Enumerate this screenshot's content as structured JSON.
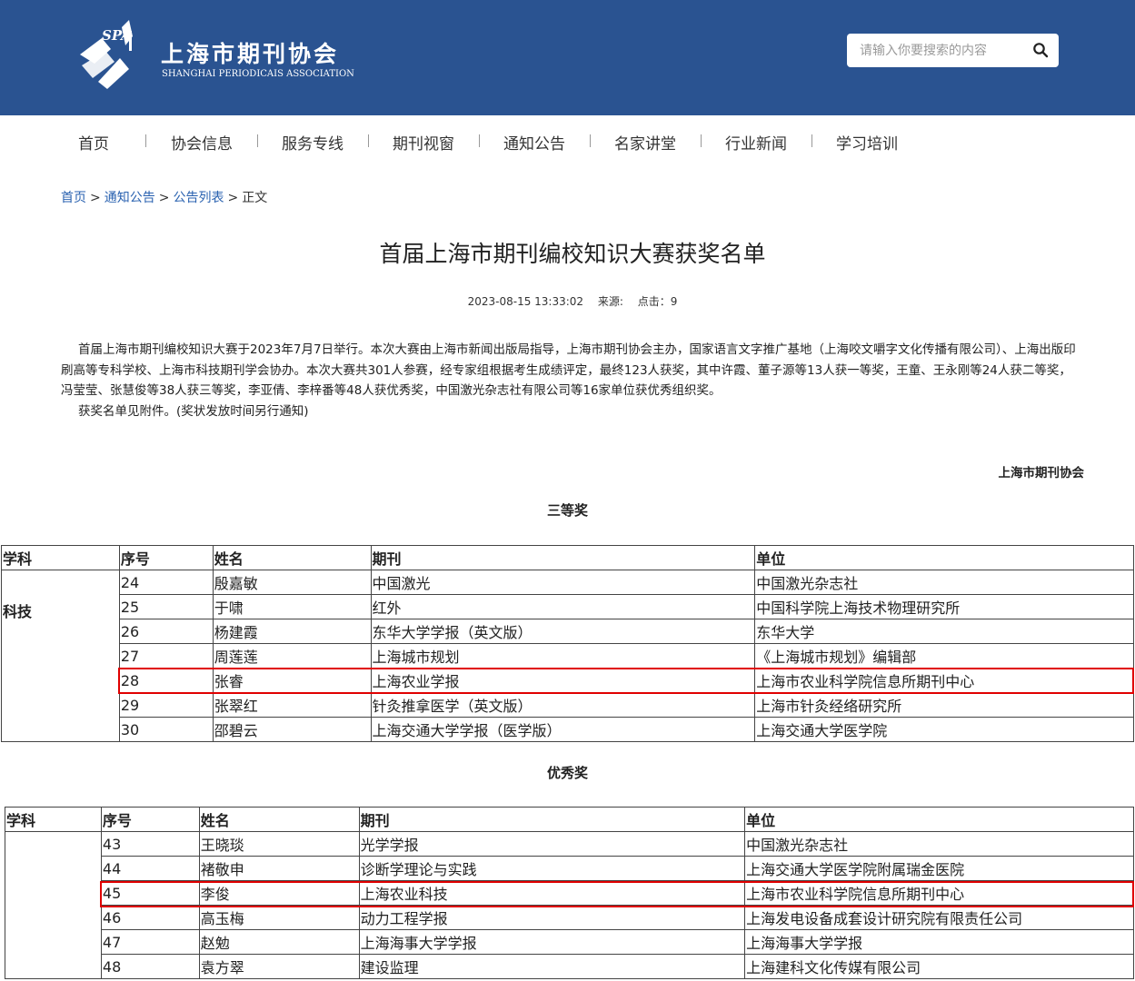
{
  "header": {
    "logo_text": "SPA",
    "title": "上海市期刊协会",
    "subtitle": "SHANGHAI PERIODICAIS ASSOCIATION",
    "search_placeholder": "请输入你要搜索的内容",
    "colors": {
      "header_bg": "#2a5391",
      "link": "#2a62b0",
      "highlight": "#e00000"
    }
  },
  "nav": {
    "items": [
      {
        "label": "首页"
      },
      {
        "label": "协会信息"
      },
      {
        "label": "服务专线"
      },
      {
        "label": "期刊视窗"
      },
      {
        "label": "通知公告"
      },
      {
        "label": "名家讲堂"
      },
      {
        "label": "行业新闻"
      },
      {
        "label": "学习培训"
      }
    ]
  },
  "breadcrumb": {
    "items": [
      "首页",
      "通知公告",
      "公告列表"
    ],
    "separator": ">",
    "current": "正文"
  },
  "article": {
    "title": "首届上海市期刊编校知识大赛获奖名单",
    "date": "2023-08-15 13:33:02",
    "source_label": "来源:",
    "clicks_label": "点击：9",
    "paragraph1": "首届上海市期刊编校知识大赛于2023年7月7日举行。本次大赛由上海市新闻出版局指导，上海市期刊协会主办，国家语言文字推广基地（上海咬文嚼字文化传播有限公司）、上海出版印刷高等专科学校、上海市科技期刊学会协办。本次大赛共301人参赛，经专家组根据考生成绩评定，最终123人获奖，其中许霞、董子源等13人获一等奖，王童、王永刚等24人获二等奖，冯莹莹、张慧俊等38人获三等奖，李亚倩、李梓番等48人获优秀奖，中国激光杂志社有限公司等16家单位获优秀组织奖。",
    "paragraph2": "获奖名单见附件。(奖状发放时间另行通知)",
    "signature": "上海市期刊协会"
  },
  "third_prize": {
    "title": "三等奖",
    "headers": [
      "学科",
      "序号",
      "姓名",
      "期刊",
      "单位"
    ],
    "subject": "科技",
    "rows": [
      [
        "24",
        "殷嘉敏",
        "中国激光",
        "中国激光杂志社"
      ],
      [
        "25",
        "于啸",
        "红外",
        "中国科学院上海技术物理研究所"
      ],
      [
        "26",
        "杨建霞",
        "东华大学学报（英文版）",
        "东华大学"
      ],
      [
        "27",
        "周莲莲",
        "上海城市规划",
        "《上海城市规划》编辑部"
      ],
      [
        "28",
        "张睿",
        "上海农业学报",
        "上海市农业科学院信息所期刊中心"
      ],
      [
        "29",
        "张翠红",
        "针灸推拿医学（英文版）",
        "上海市针灸经络研究所"
      ],
      [
        "30",
        "邵碧云",
        "上海交通大学学报（医学版）",
        "上海交通大学医学院"
      ]
    ]
  },
  "excellence_prize": {
    "title": "优秀奖",
    "headers": [
      "学科",
      "序号",
      "姓名",
      "期刊",
      "单位"
    ],
    "rows": [
      [
        "43",
        "王晓琰",
        "光学学报",
        "中国激光杂志社"
      ],
      [
        "44",
        "褚敬申",
        "诊断学理论与实践",
        "上海交通大学医学院附属瑞金医院"
      ],
      [
        "45",
        "李俊",
        "上海农业科技",
        "上海市农业科学院信息所期刊中心"
      ],
      [
        "46",
        "高玉梅",
        "动力工程学报",
        "上海发电设备成套设计研究院有限责任公司"
      ],
      [
        "47",
        "赵勉",
        "上海海事大学学报",
        "上海海事大学学报"
      ],
      [
        "48",
        "袁方翠",
        "建设监理",
        "上海建科文化传媒有限公司"
      ]
    ]
  }
}
